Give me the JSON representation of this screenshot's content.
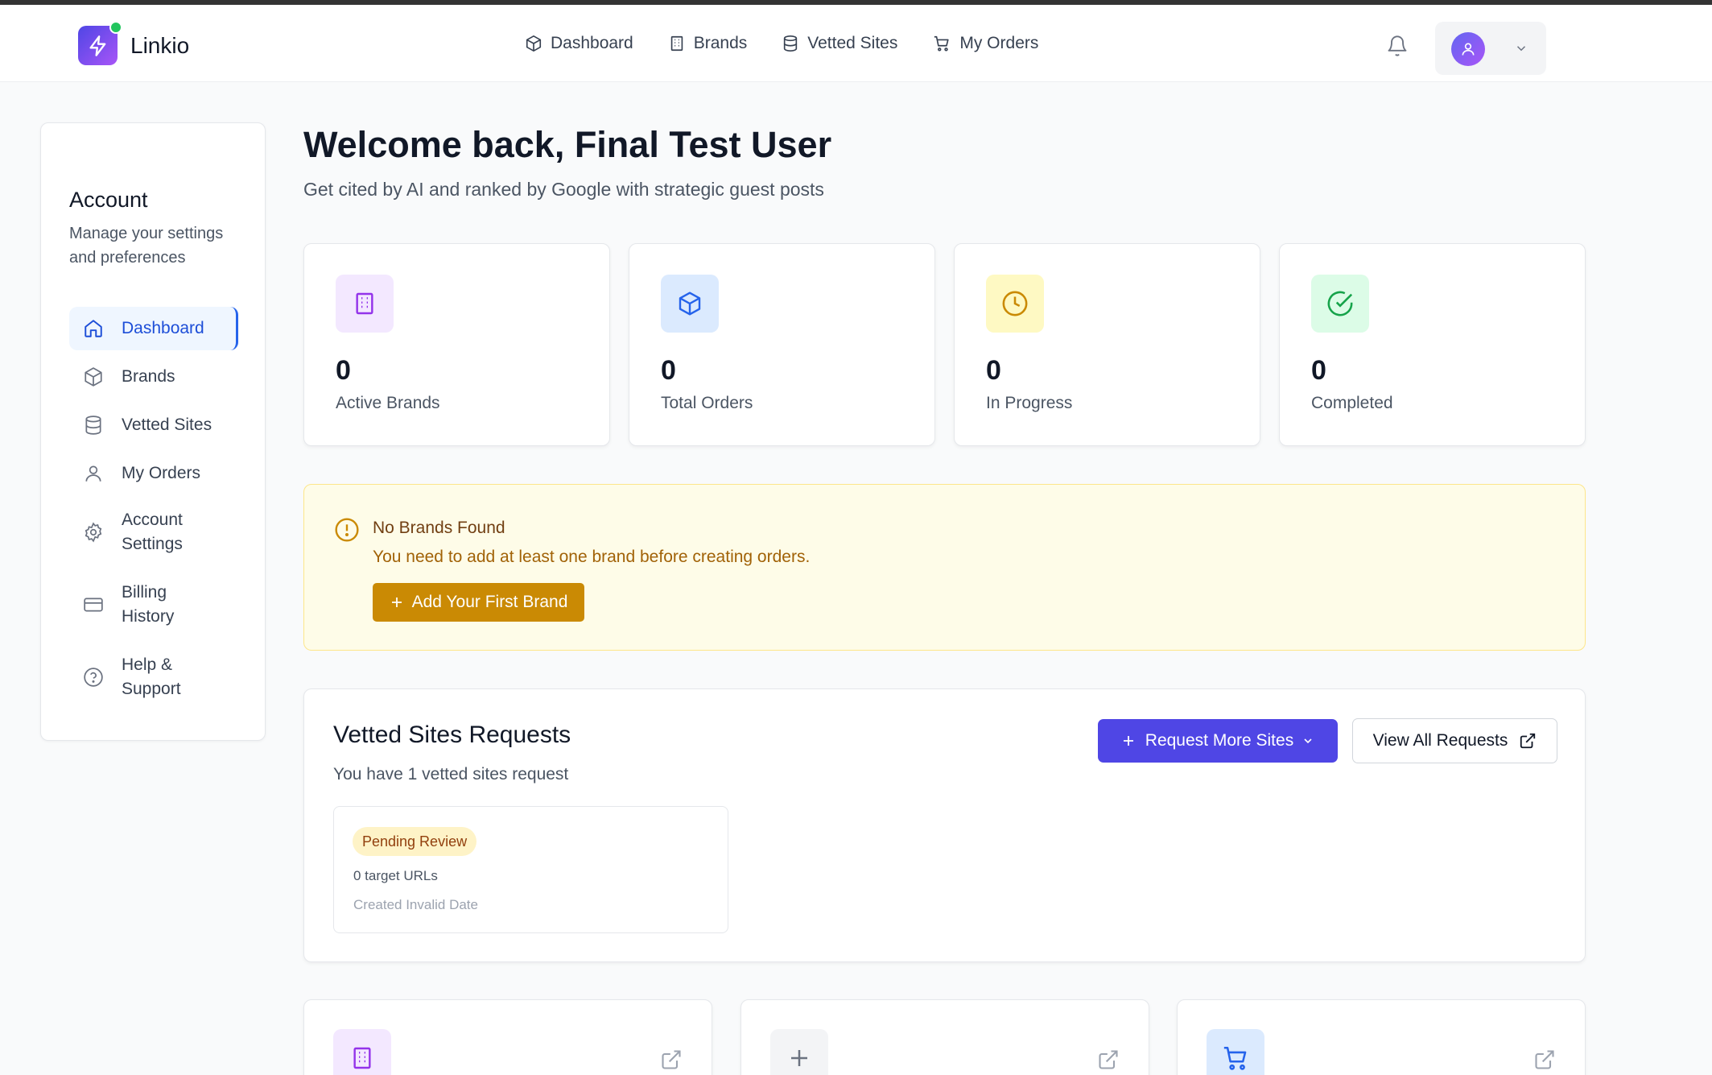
{
  "app": {
    "name": "Linkio"
  },
  "topnav": [
    {
      "label": "Dashboard",
      "icon": "cube-icon"
    },
    {
      "label": "Brands",
      "icon": "building-icon"
    },
    {
      "label": "Vetted Sites",
      "icon": "database-icon"
    },
    {
      "label": "My Orders",
      "icon": "cart-icon"
    }
  ],
  "sidebar": {
    "title": "Account",
    "subtitle": "Manage your settings and preferences",
    "items": [
      {
        "label": "Dashboard",
        "icon": "home-icon",
        "active": true
      },
      {
        "label": "Brands",
        "icon": "cube-icon"
      },
      {
        "label": "Vetted Sites",
        "icon": "database-icon"
      },
      {
        "label": "My Orders",
        "icon": "user-icon"
      },
      {
        "label": "Account Settings",
        "icon": "gear-icon"
      },
      {
        "label": "Billing History",
        "icon": "credit-card-icon"
      },
      {
        "label": "Help & Support",
        "icon": "help-circle-icon"
      }
    ]
  },
  "main": {
    "welcome": "Welcome back, Final Test User",
    "subtitle": "Get cited by AI and ranked by Google with strategic guest posts"
  },
  "stats": [
    {
      "value": "0",
      "label": "Active Brands",
      "icon": "building-icon",
      "color": "#9333ea",
      "bg": "#f3e8ff"
    },
    {
      "value": "0",
      "label": "Total Orders",
      "icon": "cube-icon",
      "color": "#2563eb",
      "bg": "#dbeafe"
    },
    {
      "value": "0",
      "label": "In Progress",
      "icon": "clock-icon",
      "color": "#ca8a04",
      "bg": "#fef9c3"
    },
    {
      "value": "0",
      "label": "Completed",
      "icon": "check-circle-icon",
      "color": "#16a34a",
      "bg": "#dcfce7"
    }
  ],
  "alert": {
    "title": "No Brands Found",
    "text": "You need to add at least one brand before creating orders.",
    "button": "Add Your First Brand"
  },
  "vetted": {
    "title": "Vetted Sites Requests",
    "subtitle": "You have 1 vetted sites request",
    "request_button": "Request More Sites",
    "view_all_button": "View All Requests",
    "requests": [
      {
        "status": "Pending Review",
        "urls": "0 target URLs",
        "created": "Created Invalid Date"
      }
    ]
  },
  "quick_actions": [
    {
      "icon": "building-icon",
      "color": "#9333ea",
      "bg": "#f3e8ff"
    },
    {
      "icon": "plus-icon",
      "color": "#6b7280",
      "bg": "#f3f4f6"
    },
    {
      "icon": "cart-icon",
      "color": "#2563eb",
      "bg": "#dbeafe"
    }
  ],
  "colors": {
    "accent": "#4f46e5",
    "active_nav": "#1d4ed8",
    "warning": "#ca8a04"
  }
}
